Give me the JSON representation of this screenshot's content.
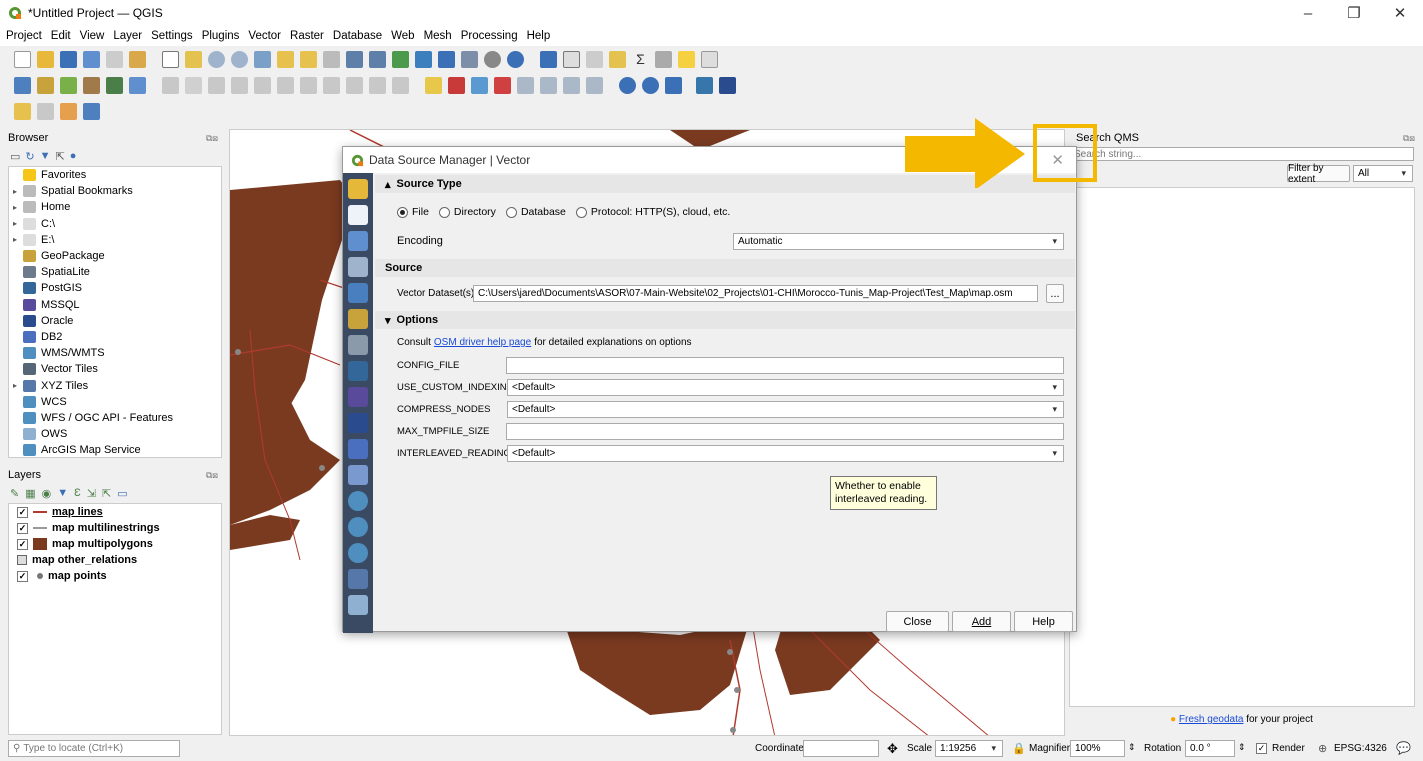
{
  "window": {
    "title": "*Untitled Project — QGIS",
    "min": "–",
    "max": "❐",
    "close": "✕"
  },
  "menu": [
    "Project",
    "Edit",
    "View",
    "Layer",
    "Settings",
    "Plugins",
    "Vector",
    "Raster",
    "Database",
    "Web",
    "Mesh",
    "Processing",
    "Help"
  ],
  "browser": {
    "title": "Browser",
    "items": [
      {
        "label": "Favorites",
        "arrow": "",
        "color": "#f5c518"
      },
      {
        "label": "Spatial Bookmarks",
        "arrow": "▸",
        "color": "#bbbbbb"
      },
      {
        "label": "Home",
        "arrow": "▸",
        "color": "#bbbbbb"
      },
      {
        "label": "C:\\",
        "arrow": "▸",
        "color": "#dddddd"
      },
      {
        "label": "E:\\",
        "arrow": "▸",
        "color": "#dddddd"
      },
      {
        "label": "GeoPackage",
        "arrow": "",
        "color": "#c8a23a"
      },
      {
        "label": "SpatiaLite",
        "arrow": "",
        "color": "#6c7b8b"
      },
      {
        "label": "PostGIS",
        "arrow": "",
        "color": "#336699"
      },
      {
        "label": "MSSQL",
        "arrow": "",
        "color": "#5a4a9c"
      },
      {
        "label": "Oracle",
        "arrow": "",
        "color": "#2a4c8f"
      },
      {
        "label": "DB2",
        "arrow": "",
        "color": "#4a6fbf"
      },
      {
        "label": "WMS/WMTS",
        "arrow": "",
        "color": "#4f8fbf"
      },
      {
        "label": "Vector Tiles",
        "arrow": "",
        "color": "#556677"
      },
      {
        "label": "XYZ Tiles",
        "arrow": "▸",
        "color": "#5577aa"
      },
      {
        "label": "WCS",
        "arrow": "",
        "color": "#4f8fbf"
      },
      {
        "label": "WFS / OGC API - Features",
        "arrow": "",
        "color": "#4f8fbf"
      },
      {
        "label": "OWS",
        "arrow": "",
        "color": "#8fb0d0"
      },
      {
        "label": "ArcGIS Map Service",
        "arrow": "",
        "color": "#4f8fbf"
      }
    ]
  },
  "layers": {
    "title": "Layers",
    "items": [
      {
        "label": "map lines",
        "checked": "✓",
        "underline": true,
        "sym": "line",
        "color": "#b03a2e"
      },
      {
        "label": "map multilinestrings",
        "checked": "✓",
        "underline": false,
        "sym": "line",
        "color": "#999999"
      },
      {
        "label": "map multipolygons",
        "checked": "✓",
        "underline": false,
        "sym": "poly",
        "color": "#7a3a20"
      },
      {
        "label": "map other_relations",
        "checked": "",
        "underline": false,
        "sym": "table",
        "color": "#666666"
      },
      {
        "label": "map points",
        "checked": "✓",
        "underline": false,
        "sym": "point",
        "color": "#777777"
      }
    ]
  },
  "dialog": {
    "title": "Data Source Manager | Vector",
    "source_type_label": "Source Type",
    "radios": [
      {
        "label": "File",
        "on": true
      },
      {
        "label": "Directory",
        "on": false
      },
      {
        "label": "Database",
        "on": false
      },
      {
        "label": "Protocol: HTTP(S), cloud, etc.",
        "on": false
      }
    ],
    "encoding_label": "Encoding",
    "encoding_value": "Automatic",
    "source_label": "Source",
    "dataset_label": "Vector Dataset(s)",
    "dataset_value": "C:\\Users\\jared\\Documents\\ASOR\\07-Main-Website\\02_Projects\\01-CHI\\Morocco-Tunis_Map-Project\\Test_Map\\map.osm",
    "browse": "...",
    "options_label": "Options",
    "consult_pre": "Consult ",
    "consult_link": "OSM driver help page",
    "consult_post": " for detailed explanations on options",
    "options": [
      {
        "name": "CONFIG_FILE",
        "value": "",
        "select": false
      },
      {
        "name": "USE_CUSTOM_INDEXING",
        "value": "<Default>",
        "select": true
      },
      {
        "name": "COMPRESS_NODES",
        "value": "<Default>",
        "select": true
      },
      {
        "name": "MAX_TMPFILE_SIZE",
        "value": "",
        "select": false
      },
      {
        "name": "INTERLEAVED_READING",
        "value": "<Default>",
        "select": true
      }
    ],
    "tooltip": "Whether to enable interleaved reading.",
    "close_btn": "Close",
    "add_btn": "Add",
    "help_btn": "Help"
  },
  "qms": {
    "title": "Search QMS",
    "placeholder": "Search string...",
    "filter_btn": "Filter by extent",
    "all_value": "All",
    "footer_link": "Fresh geodata",
    "footer_text": " for your project"
  },
  "status": {
    "locate_placeholder": "Type to locate (Ctrl+K)",
    "coordinate_label": "Coordinate",
    "coordinate_value": "",
    "scale_label": "Scale",
    "scale_value": "1:19256",
    "magnifier_label": "Magnifier",
    "magnifier_value": "100%",
    "rotation_label": "Rotation",
    "rotation_value": "0.0 °",
    "render_label": "Render",
    "render_checked": "✓",
    "crs": "EPSG:4326"
  },
  "annotation": {
    "arrow_color": "#f5b800"
  }
}
